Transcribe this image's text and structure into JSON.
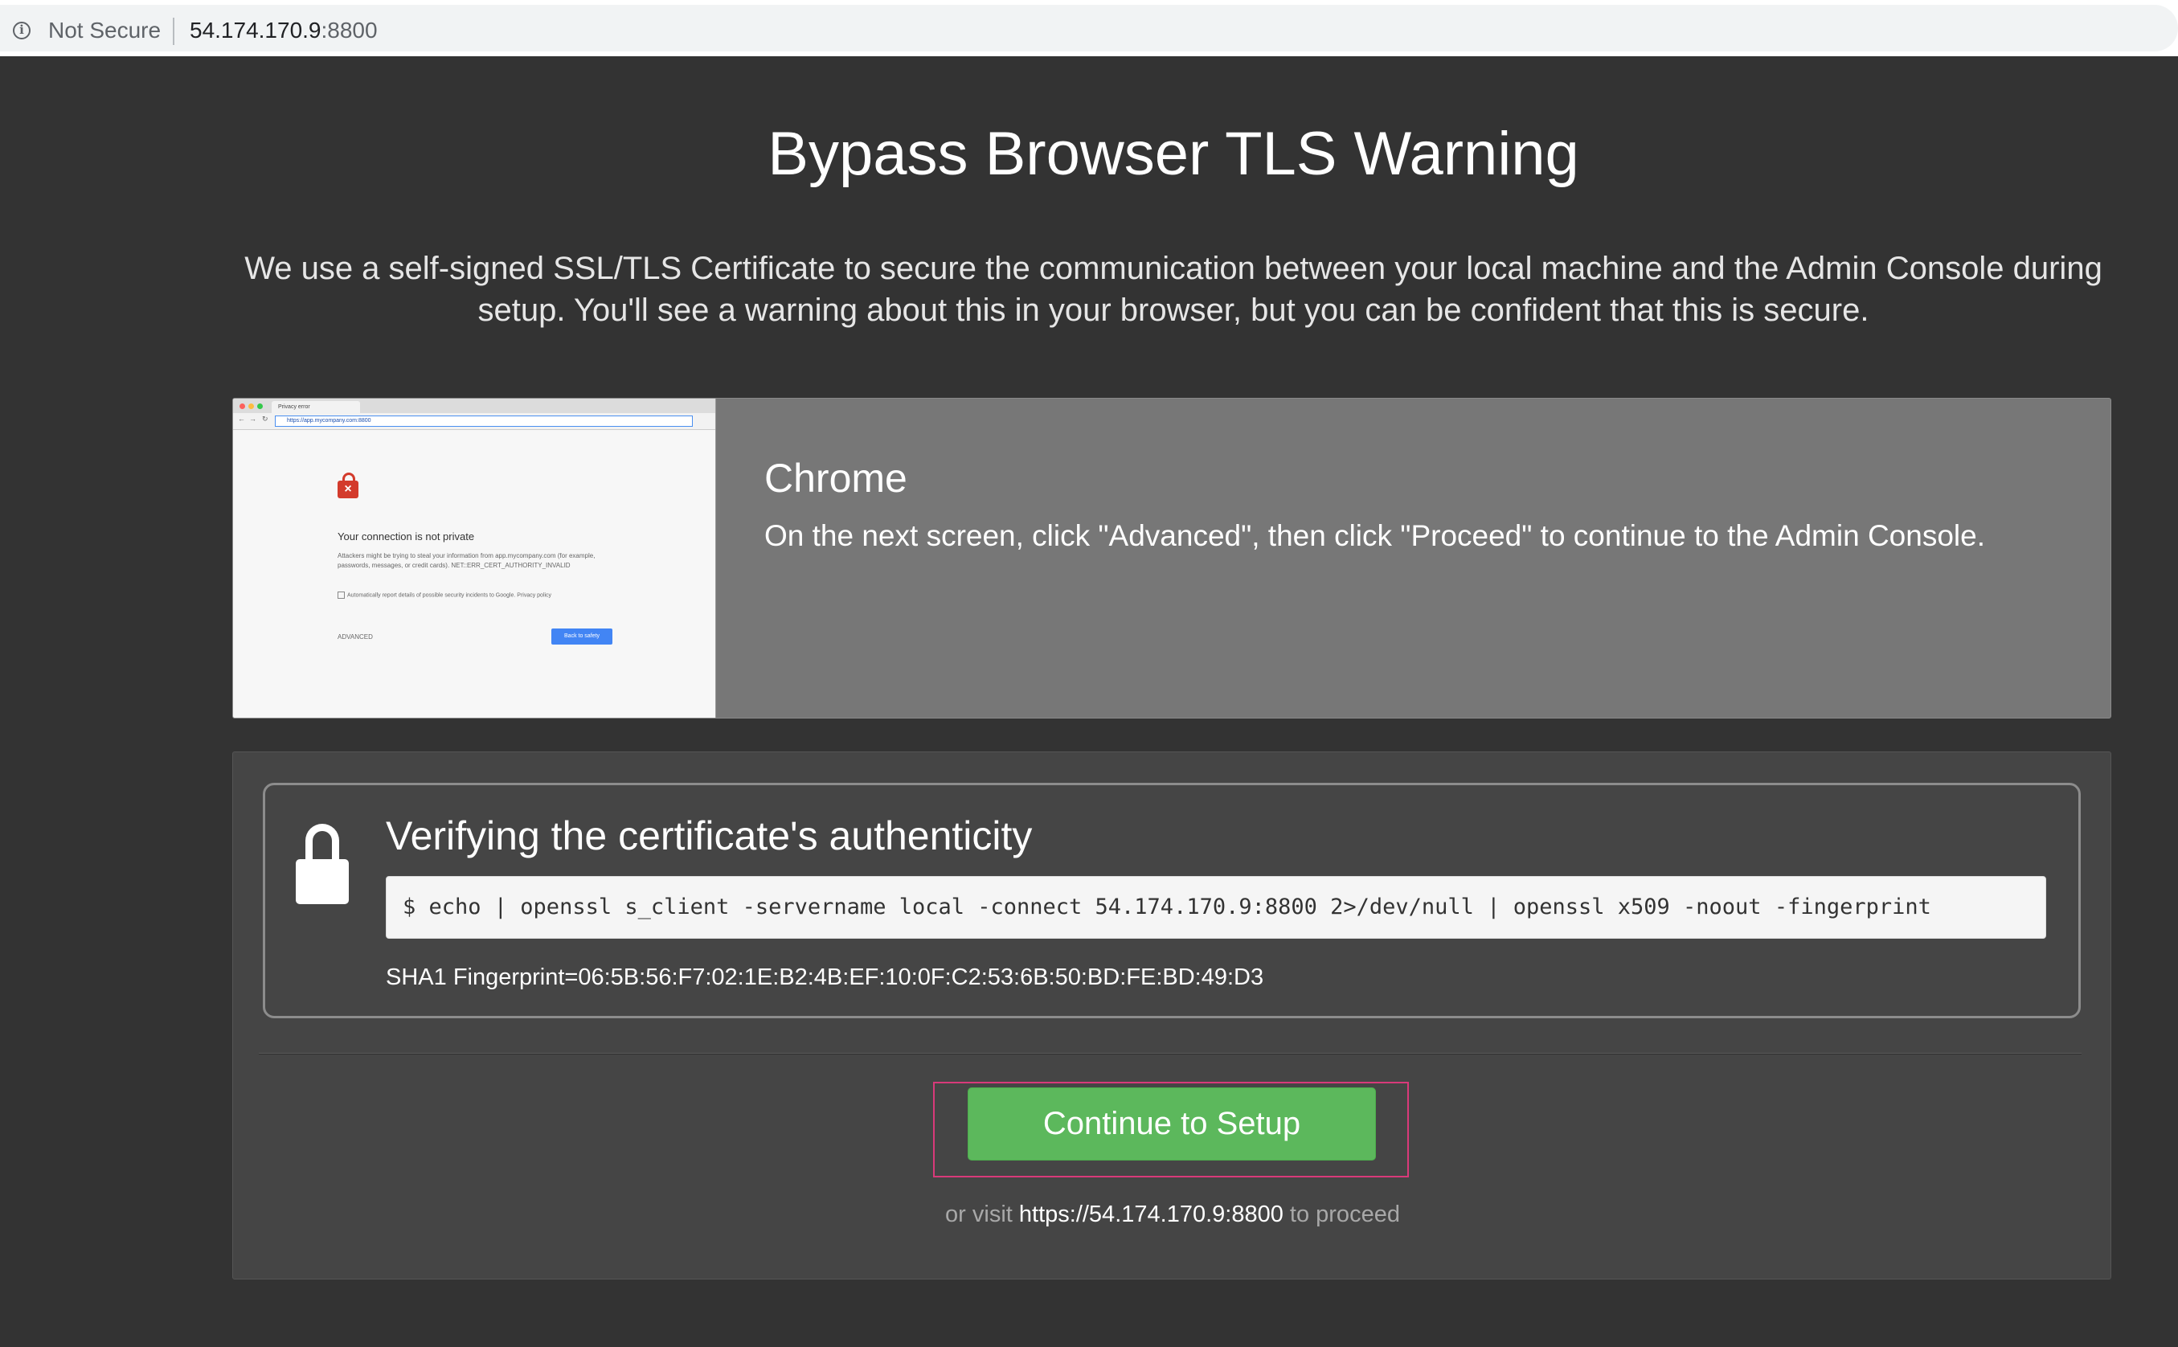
{
  "browser": {
    "security_label": "Not Secure",
    "url_host": "54.174.170.9",
    "url_port": ":8800"
  },
  "page": {
    "title": "Bypass Browser TLS Warning",
    "intro": "We use a self-signed SSL/TLS Certificate to secure the communication between your local machine and the Admin Console during setup. You'll see a warning about this in your browser, but you can be confident that this is secure."
  },
  "browser_card": {
    "name": "Chrome",
    "instruction": "On the next screen, click \"Advanced\", then click \"Proceed\" to continue to the Admin Console.",
    "thumbnail": {
      "tab_label": "Privacy error",
      "url": "https://app.mycompany.com:8800",
      "heading": "Your connection is not private",
      "body": "Attackers might be trying to steal your information from app.mycompany.com (for example, passwords, messages, or credit cards). NET::ERR_CERT_AUTHORITY_INVALID",
      "checkbox": "Automatically report details of possible security incidents to Google. Privacy policy",
      "advanced": "ADVANCED",
      "back_button": "Back to safety"
    }
  },
  "verification": {
    "title": "Verifying the certificate's authenticity",
    "command": "$ echo | openssl s_client -servername local -connect 54.174.170.9:8800 2>/dev/null | openssl x509 -noout -fingerprint",
    "fingerprint": "SHA1 Fingerprint=06:5B:56:F7:02:1E:B2:4B:EF:10:0F:C2:53:6B:50:BD:FE:BD:49:D3"
  },
  "actions": {
    "continue_label": "Continue to Setup",
    "or_visit_prefix": "or visit",
    "or_visit_link": "https://54.174.170.9:8800",
    "or_visit_suffix": "to proceed"
  },
  "colors": {
    "background": "#333333",
    "card": "#777777",
    "panel": "#454545",
    "button": "#5cb85c",
    "focus": "#d93a7a"
  }
}
